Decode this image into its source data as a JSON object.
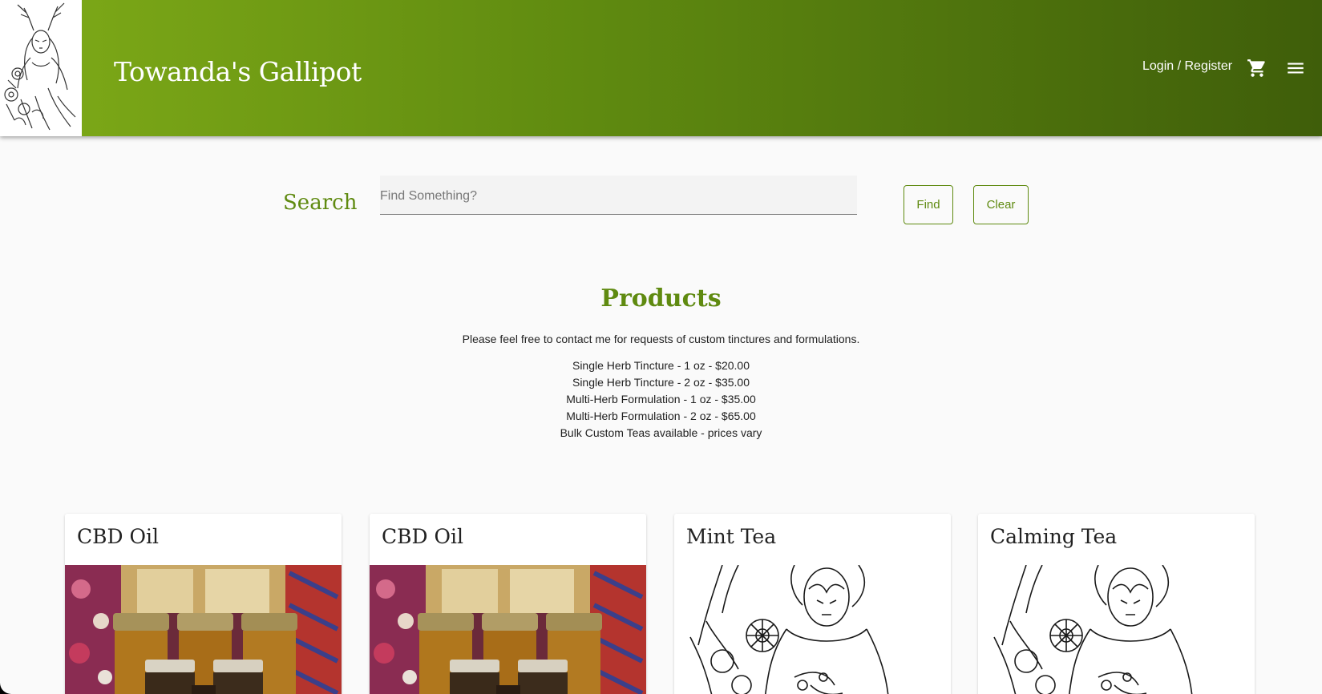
{
  "header": {
    "site_title": "Towanda's Gallipot",
    "login_label": "Login / Register",
    "cart_icon": "shopping-cart-icon",
    "menu_icon": "hamburger-menu-icon",
    "brand_color": "#6b9614"
  },
  "search": {
    "label": "Search",
    "placeholder": "Find Something?",
    "value": "",
    "find_label": "Find",
    "clear_label": "Clear"
  },
  "products": {
    "title": "Products",
    "intro": "Please feel free to contact me for requests of custom tinctures and formulations.",
    "price_list": [
      "Single Herb Tincture - 1 oz - $20.00",
      "Single Herb Tincture - 2 oz - $35.00",
      "Multi-Herb Formulation - 1 oz - $35.00",
      "Multi-Herb Formulation - 2 oz - $65.00",
      "Bulk Custom Teas available - prices vary"
    ],
    "cards": [
      {
        "title": "CBD Oil",
        "image": "jars-photo"
      },
      {
        "title": "CBD Oil",
        "image": "jars-photo"
      },
      {
        "title": "Mint Tea",
        "image": "line-art-illustration"
      },
      {
        "title": "Calming Tea",
        "image": "line-art-illustration"
      }
    ]
  }
}
